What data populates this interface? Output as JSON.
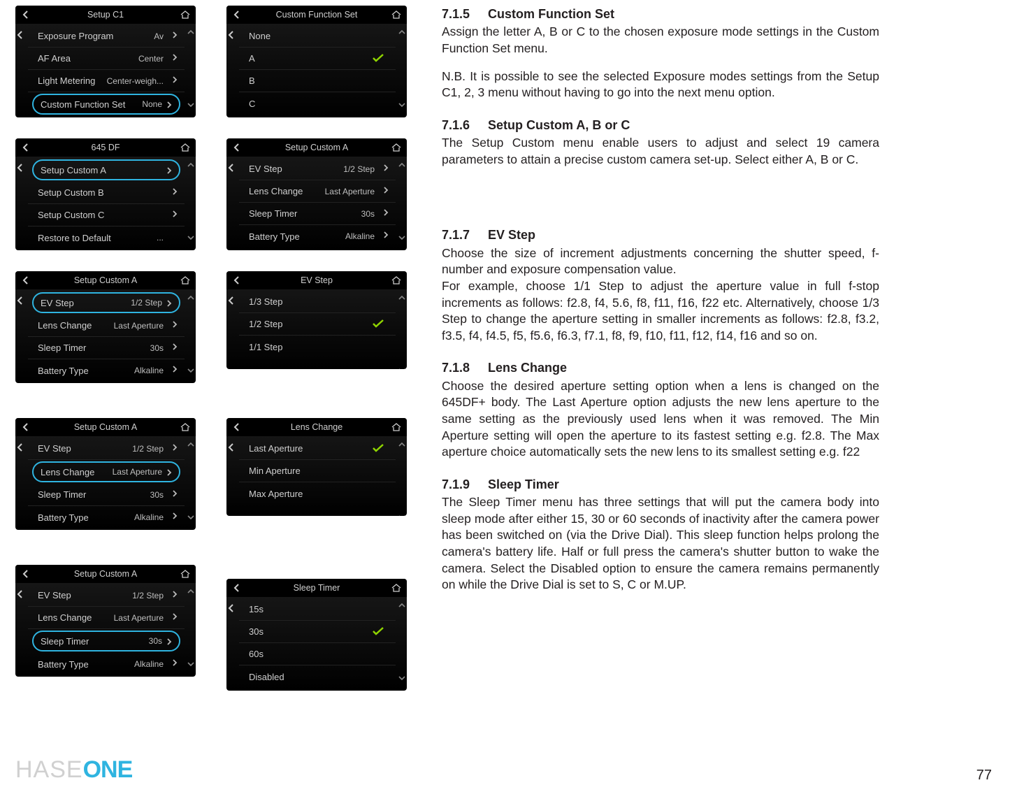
{
  "page_number": "77",
  "logo": {
    "gray": "HASE",
    "blue": "ONE"
  },
  "sections": [
    {
      "num": "7.1.5",
      "title": "Custom Function Set",
      "paras": [
        "Assign the letter A, B or C to the chosen exposure mode settings in the Custom Function Set menu.",
        "N.B. It is possible to see the selected Exposure modes settings from the Setup C1, 2, 3 menu without having to go into the next menu option."
      ]
    },
    {
      "num": "7.1.6",
      "title": "Setup Custom A, B or C",
      "paras": [
        "The Setup Custom menu enable users to adjust and select 19 camera parameters to attain a precise custom camera set-up. Select either A, B or C."
      ]
    },
    {
      "num": "7.1.7",
      "title": "EV Step",
      "paras": [
        "Choose the size of increment adjustments concerning the shutter speed, f-number and exposure compensation value.",
        "For example, choose 1/1 Step to adjust the aperture value in full f-stop increments as follows: f2.8, f4, 5.6, f8, f11, f16, f22 etc. Alternatively, choose 1/3 Step to change the aperture setting in smaller increments as follows: f2.8, f3.2, f3.5, f4, f4.5, f5, f5.6, f6.3, f7.1, f8, f9, f10, f11, f12, f14, f16 and so on."
      ]
    },
    {
      "num": "7.1.8",
      "title": "Lens Change",
      "paras": [
        "Choose the desired aperture setting option when a lens is changed on the 645DF+ body. The Last Aperture option adjusts the new lens aperture to the same setting as the previously used lens when it was removed. The Min Aperture setting will open the aperture to its fastest setting e.g. f2.8. The Max aperture choice automatically sets the new lens to its smallest setting e.g. f22"
      ]
    },
    {
      "num": "7.1.9",
      "title": "Sleep Timer",
      "paras": [
        "The Sleep Timer menu has three settings that will put the camera body into sleep mode after either 15, 30 or 60 seconds of inactivity after the camera power has been switched on (via the Drive Dial). This sleep function helps prolong the camera's battery life. Half or full press the camera's shutter button to wake the camera. Select the Disabled option to ensure the camera remains permanently on while the Drive Dial is set to S, C or M.UP."
      ]
    }
  ],
  "screens": {
    "setup_c1": {
      "title": "Setup C1",
      "rows": [
        {
          "label": "Exposure Program",
          "value": "Av",
          "chev": true
        },
        {
          "label": "AF Area",
          "value": "Center",
          "chev": true
        },
        {
          "label": "Light Metering",
          "value": "Center-weigh...",
          "chev": true
        },
        {
          "label": "Custom Function Set",
          "value": "None",
          "chev": true,
          "selected": true
        }
      ]
    },
    "custom_fn_set": {
      "title": "Custom Function Set",
      "rows": [
        {
          "label": "None"
        },
        {
          "label": "A",
          "checked": true
        },
        {
          "label": "B"
        },
        {
          "label": "C"
        }
      ]
    },
    "menu_645df": {
      "title": "645 DF",
      "rows": [
        {
          "label": "Setup Custom A",
          "chev": true,
          "selected": true
        },
        {
          "label": "Setup Custom B",
          "chev": true
        },
        {
          "label": "Setup Custom C",
          "chev": true
        },
        {
          "label": "Restore to Default",
          "value": "...",
          "chev": false
        }
      ]
    },
    "setup_custom_a_plain": {
      "title": "Setup Custom A",
      "rows": [
        {
          "label": "EV Step",
          "value": "1/2 Step",
          "chev": true
        },
        {
          "label": "Lens Change",
          "value": "Last Aperture",
          "chev": true
        },
        {
          "label": "Sleep Timer",
          "value": "30s",
          "chev": true
        },
        {
          "label": "Battery Type",
          "value": "Alkaline",
          "chev": true
        }
      ]
    },
    "setup_custom_a_ev": {
      "title": "Setup Custom A",
      "rows": [
        {
          "label": "EV Step",
          "value": "1/2 Step",
          "chev": true,
          "selected": true
        },
        {
          "label": "Lens Change",
          "value": "Last Aperture",
          "chev": true
        },
        {
          "label": "Sleep Timer",
          "value": "30s",
          "chev": true
        },
        {
          "label": "Battery Type",
          "value": "Alkaline",
          "chev": true
        }
      ]
    },
    "ev_step": {
      "title": "EV Step",
      "rows": [
        {
          "label": "1/3 Step"
        },
        {
          "label": "1/2 Step",
          "checked": true
        },
        {
          "label": "1/1 Step"
        }
      ]
    },
    "setup_custom_a_lens": {
      "title": "Setup Custom A",
      "rows": [
        {
          "label": "EV Step",
          "value": "1/2 Step",
          "chev": true
        },
        {
          "label": "Lens Change",
          "value": "Last Aperture",
          "chev": true,
          "selected": true
        },
        {
          "label": "Sleep Timer",
          "value": "30s",
          "chev": true
        },
        {
          "label": "Battery Type",
          "value": "Alkaline",
          "chev": true
        }
      ]
    },
    "lens_change": {
      "title": "Lens Change",
      "rows": [
        {
          "label": "Last Aperture",
          "checked": true
        },
        {
          "label": "Min Aperture"
        },
        {
          "label": "Max Aperture"
        }
      ]
    },
    "setup_custom_a_sleep": {
      "title": "Setup Custom A",
      "rows": [
        {
          "label": "EV Step",
          "value": "1/2 Step",
          "chev": true
        },
        {
          "label": "Lens Change",
          "value": "Last Aperture",
          "chev": true
        },
        {
          "label": "Sleep Timer",
          "value": "30s",
          "chev": true,
          "selected": true
        },
        {
          "label": "Battery Type",
          "value": "Alkaline",
          "chev": true
        }
      ]
    },
    "sleep_timer": {
      "title": "Sleep Timer",
      "rows": [
        {
          "label": "15s"
        },
        {
          "label": "30s",
          "checked": true
        },
        {
          "label": "60s"
        },
        {
          "label": "Disabled"
        }
      ]
    }
  }
}
